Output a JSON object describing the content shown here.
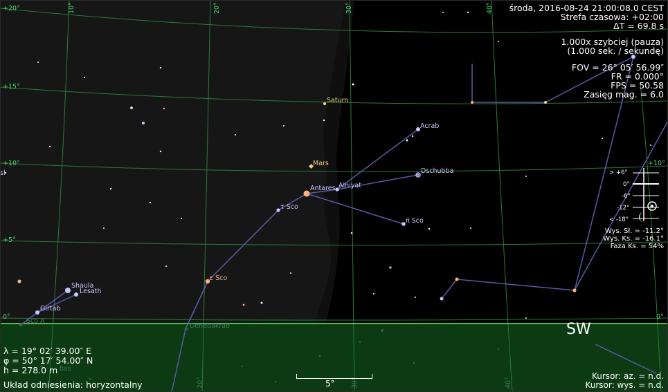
{
  "info": {
    "datetime": "środa, 2016-08-24 21:00:08.0 CEST",
    "timezone": "Strefa czasowa: +02:00",
    "delta_t": "ΔT = 69.8 s",
    "speed": "1.000x szybciej (pauza)",
    "speed_unit": "(1.000 sek. / sekundę)",
    "fov": "FOV = 26° 05′ 56.99″",
    "fr": "FR = 0.000°",
    "fps": "FPS = 50.58",
    "mag_limit": "Zasięg mag. = 6.0"
  },
  "location": {
    "lambda": "λ = 19° 02′ 39.00″ E",
    "phi": "φ = 50° 17′ 54.00″ N",
    "height": "h = 278.0 m"
  },
  "reference_frame": "Układ odniesienia: horyzontalny",
  "cursor": {
    "az": "Kursor: az. = n.d.",
    "alt": "Kursor: wys. = n.d."
  },
  "direction_label": "SW",
  "scale_label": "5°",
  "altitude_labels": [
    "+20°",
    "+15°",
    "+10°",
    "+5°",
    "0°",
    "+10°",
    "0°"
  ],
  "azimuth_labels": [
    "10°",
    "20°",
    "30°",
    "40°",
    "20°",
    "30°",
    "40°"
  ],
  "twilight": {
    "levels": [
      "> +6°",
      "0°",
      "-6°",
      "-12°",
      "< -18°"
    ],
    "sun_alt": "Wys. Sł. = -11.2°",
    "moon_alt": "Wys. Ks. = -16.1°",
    "moon_phase": "Faza Ks. = 54%"
  },
  "star_labels": [
    "Antares",
    "Alniyat",
    "Acrab",
    "Dschubba",
    "π Sco",
    "τ Sco",
    "ε Sco",
    "Shaula",
    "Lesath",
    "Girtab",
    "Denebakrab"
  ],
  "planet_labels": [
    "Saturn",
    "Mars"
  ],
  "edge_labels": [
    "sl",
    "Sco A",
    "bas"
  ],
  "colors": {
    "sky": "#000000",
    "ground": "#0b3a13",
    "horizon": "#49c24a",
    "grid": "#2c7a3c",
    "constellation": "#5a5aa8",
    "planet": "#e8d27a"
  }
}
